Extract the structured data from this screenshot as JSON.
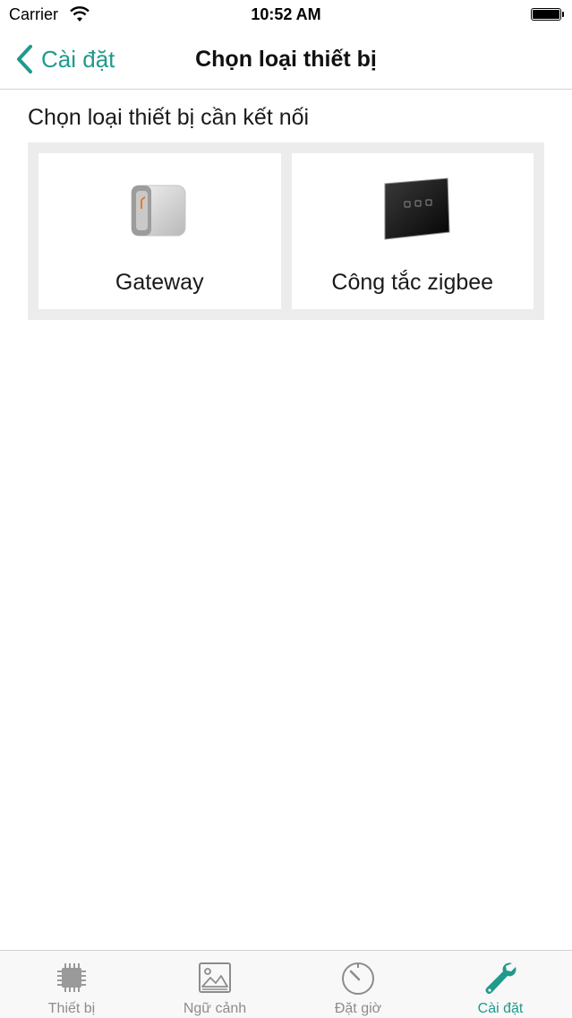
{
  "status_bar": {
    "carrier": "Carrier",
    "time": "10:52 AM"
  },
  "nav": {
    "back_label": "Cài đặt",
    "title": "Chọn loại thiết bị"
  },
  "content": {
    "heading": "Chọn loại thiết bị cần kết nối",
    "tiles": [
      {
        "label": "Gateway",
        "icon": "gateway-device-icon"
      },
      {
        "label": "Công tắc zigbee",
        "icon": "zigbee-switch-icon"
      }
    ]
  },
  "tab_bar": {
    "items": [
      {
        "label": "Thiết bị",
        "icon": "chip-icon",
        "active": false
      },
      {
        "label": "Ngữ cảnh",
        "icon": "picture-icon",
        "active": false
      },
      {
        "label": "Đặt giờ",
        "icon": "timer-icon",
        "active": false
      },
      {
        "label": "Cài đặt",
        "icon": "wrench-icon",
        "active": true
      }
    ]
  },
  "colors": {
    "accent": "#1f9a8c",
    "inactive": "#8c8c8c",
    "grid_background": "#ececec"
  }
}
